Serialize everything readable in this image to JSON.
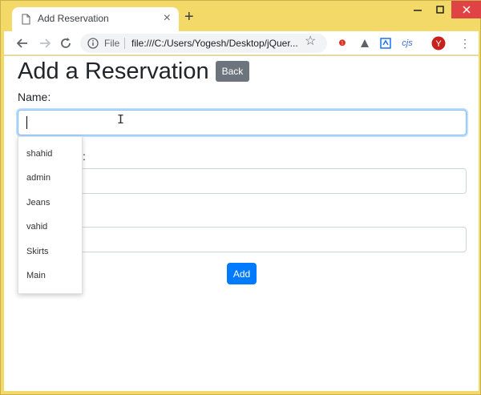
{
  "browser": {
    "tab_title": "Add Reservation",
    "new_tab": "+",
    "close_tab": "×",
    "site_label": "File",
    "url": "file:///C:/Users/Yogesh/Desktop/jQuer...",
    "window_min": "–",
    "window_max": "☐",
    "window_close": "✕"
  },
  "page": {
    "title": "Add a Reservation",
    "back_label": "Back",
    "name_label": "Name:",
    "name_value": "",
    "field2_label_partial": ":",
    "add_label": "Add"
  },
  "autocomplete": {
    "items": [
      "shahid",
      "admin",
      "Jeans",
      "vahid",
      "Skirts",
      "Main"
    ]
  },
  "colors": {
    "window_frame": "#f2d968",
    "primary": "#007bff",
    "secondary": "#6c757d",
    "close": "#e04343"
  }
}
